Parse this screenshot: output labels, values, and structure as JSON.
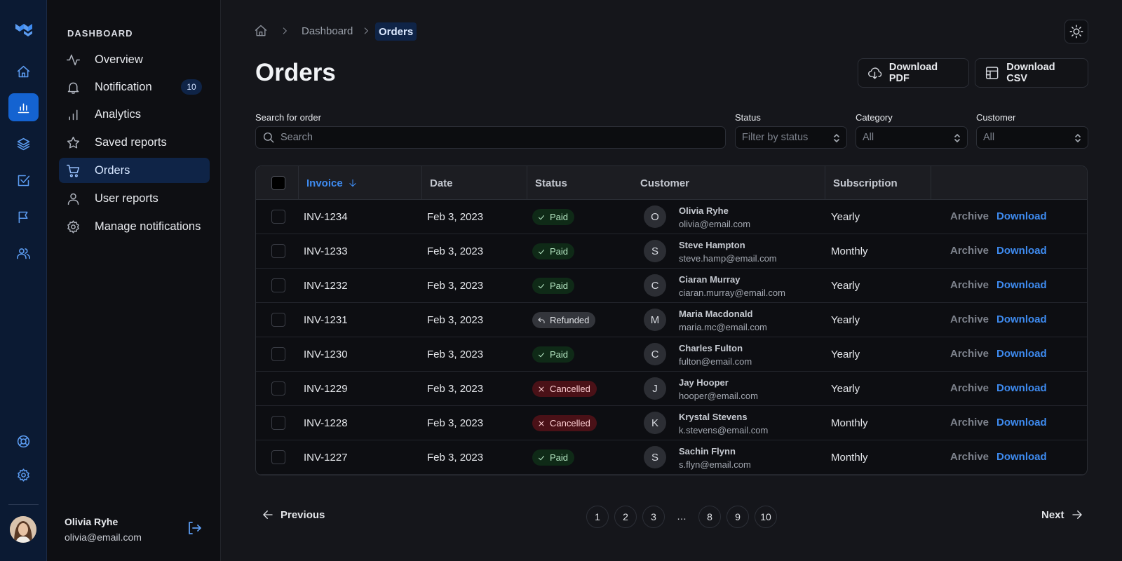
{
  "sidebar": {
    "section_title": "DASHBOARD",
    "items": [
      {
        "label": "Overview"
      },
      {
        "label": "Notification",
        "badge": "10"
      },
      {
        "label": "Analytics"
      },
      {
        "label": "Saved reports"
      },
      {
        "label": "Orders",
        "active": true
      },
      {
        "label": "User reports"
      },
      {
        "label": "Manage notifications"
      }
    ],
    "user": {
      "name": "Olivia Ryhe",
      "email": "olivia@email.com"
    }
  },
  "breadcrumb": {
    "parent": "Dashboard",
    "current": "Orders"
  },
  "page": {
    "title": "Orders"
  },
  "actions": {
    "download_pdf": "Download PDF",
    "download_csv": "Download CSV"
  },
  "filters": {
    "search_label": "Search for order",
    "search_placeholder": "Search",
    "status_label": "Status",
    "status_value": "Filter by status",
    "category_label": "Category",
    "category_value": "All",
    "customer_label": "Customer",
    "customer_value": "All"
  },
  "table": {
    "columns": {
      "invoice": "Invoice",
      "date": "Date",
      "status": "Status",
      "customer": "Customer",
      "subscription": "Subscription"
    },
    "archive_label": "Archive",
    "download_label": "Download",
    "rows": [
      {
        "invoice": "INV-1234",
        "date": "Feb 3, 2023",
        "status": "Paid",
        "initial": "O",
        "name": "Olivia Ryhe",
        "email": "olivia@email.com",
        "subscription": "Yearly"
      },
      {
        "invoice": "INV-1233",
        "date": "Feb 3, 2023",
        "status": "Paid",
        "initial": "S",
        "name": "Steve Hampton",
        "email": "steve.hamp@email.com",
        "subscription": "Monthly"
      },
      {
        "invoice": "INV-1232",
        "date": "Feb 3, 2023",
        "status": "Paid",
        "initial": "C",
        "name": "Ciaran Murray",
        "email": "ciaran.murray@email.com",
        "subscription": "Yearly"
      },
      {
        "invoice": "INV-1231",
        "date": "Feb 3, 2023",
        "status": "Refunded",
        "initial": "M",
        "name": "Maria Macdonald",
        "email": "maria.mc@email.com",
        "subscription": "Yearly"
      },
      {
        "invoice": "INV-1230",
        "date": "Feb 3, 2023",
        "status": "Paid",
        "initial": "C",
        "name": "Charles Fulton",
        "email": "fulton@email.com",
        "subscription": "Yearly"
      },
      {
        "invoice": "INV-1229",
        "date": "Feb 3, 2023",
        "status": "Cancelled",
        "initial": "J",
        "name": "Jay Hooper",
        "email": "hooper@email.com",
        "subscription": "Yearly"
      },
      {
        "invoice": "INV-1228",
        "date": "Feb 3, 2023",
        "status": "Cancelled",
        "initial": "K",
        "name": "Krystal Stevens",
        "email": "k.stevens@email.com",
        "subscription": "Monthly"
      },
      {
        "invoice": "INV-1227",
        "date": "Feb 3, 2023",
        "status": "Paid",
        "initial": "S",
        "name": "Sachin Flynn",
        "email": "s.flyn@email.com",
        "subscription": "Monthly"
      }
    ]
  },
  "pagination": {
    "previous": "Previous",
    "next": "Next",
    "pages": [
      "1",
      "2",
      "3",
      "8",
      "9",
      "10"
    ],
    "ellipsis": "…"
  },
  "colors": {
    "accent": "#3e8bf0",
    "rail_bg": "#0b1a33",
    "paid": "#0f2a17",
    "cancelled": "#4a1117",
    "refunded": "#33353b"
  }
}
